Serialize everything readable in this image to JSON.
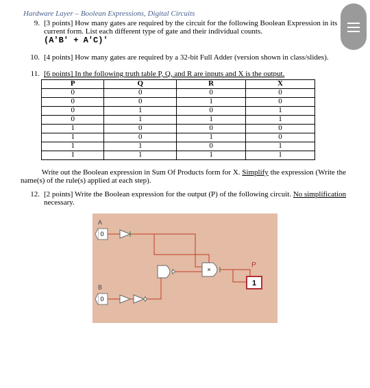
{
  "section_title": "Hardware Layer – Boolean Expressions, Digital Circuits",
  "q9": {
    "number": "9.",
    "text": "[3 points] How many gates are required by the circuit for the following Boolean Expression in its current form. List each different type of gate and their individual counts.",
    "expr": "(A'B' + A'C)'"
  },
  "q10": {
    "number": "10.",
    "text": "[4 points] How many gates are required by a 32-bit Full Adder (version shown in class/slides)."
  },
  "q11": {
    "number": "11.",
    "lead": "[6 points] In the following truth table P, Q, and R are inputs and X is the output.",
    "headers": [
      "P",
      "Q",
      "R",
      "X"
    ],
    "rows": [
      [
        "0",
        "0",
        "0",
        "0"
      ],
      [
        "0",
        "0",
        "1",
        "0"
      ],
      [
        "0",
        "1",
        "0",
        "1"
      ],
      [
        "0",
        "1",
        "1",
        "1"
      ],
      [
        "1",
        "0",
        "0",
        "0"
      ],
      [
        "1",
        "0",
        "1",
        "0"
      ],
      [
        "1",
        "1",
        "0",
        "1"
      ],
      [
        "1",
        "1",
        "1",
        "1"
      ]
    ],
    "para_prefix": "Write out the Boolean expression in Sum Of Products form for X. ",
    "para_simplify": "Simplify",
    "para_suffix": " the expression (Write the name(s) of the rule(s) applied at each step)."
  },
  "q12": {
    "number": "12.",
    "text_prefix": "[2 points] Write the Boolean expression for the output (P) of the following circuit. ",
    "no_simpl": "No simplification",
    "text_suffix": " necessary."
  },
  "circuit": {
    "inputA": "A",
    "inputB": "B",
    "constA": "0",
    "constB": "0",
    "const1": "1",
    "outLabel": "P",
    "mult": "×"
  }
}
